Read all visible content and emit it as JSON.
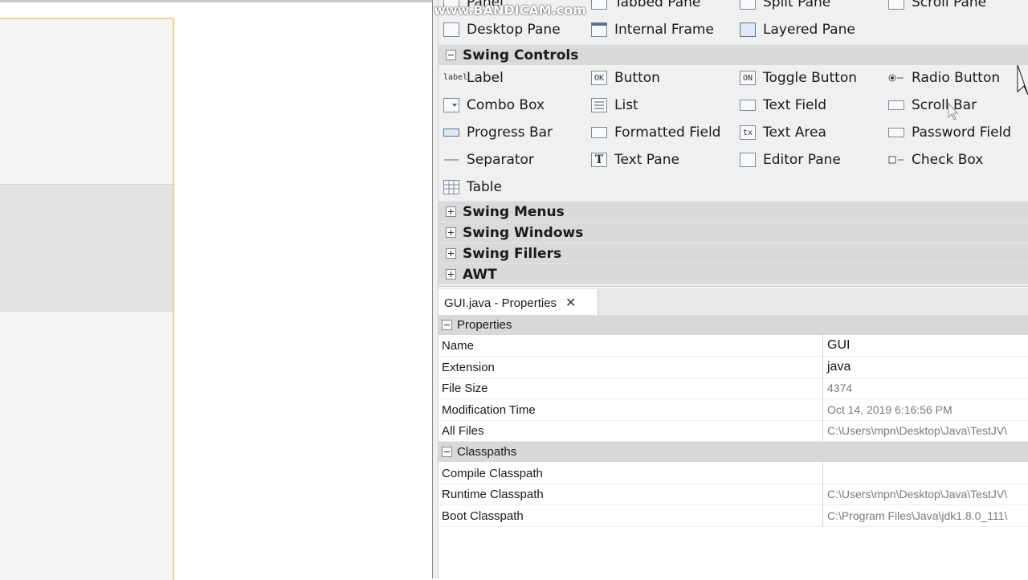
{
  "watermark": "www.BANDICAM.com",
  "palette": {
    "top_partial_row": [
      "Panel",
      "Tabbed Pane",
      "Split Pane",
      "Scroll Pane"
    ],
    "containers_row2": [
      "Desktop Pane",
      "Internal Frame",
      "Layered Pane"
    ],
    "swing_controls": {
      "header": "Swing Controls",
      "rows": [
        [
          "Label",
          "Button",
          "Toggle Button",
          "Radio Button"
        ],
        [
          "Combo Box",
          "List",
          "Text Field",
          "Scroll Bar"
        ],
        [
          "Progress Bar",
          "Formatted Field",
          "Text Area",
          "Password Field"
        ],
        [
          "Separator",
          "Text Pane",
          "Editor Pane",
          "Check Box"
        ],
        [
          "Table"
        ]
      ],
      "icon_labels": {
        "label": "label",
        "button": "OK",
        "toggle": "ON",
        "text_area": "tx"
      }
    },
    "collapsed_categories": [
      "Swing Menus",
      "Swing Windows",
      "Swing Fillers",
      "AWT"
    ]
  },
  "properties_panel": {
    "tab_label": "GUI.java - Properties",
    "close_glyph": "✕",
    "sections": [
      {
        "title": "Properties",
        "rows": [
          {
            "name": "Name",
            "value": "GUI"
          },
          {
            "name": "Extension",
            "value": "java"
          },
          {
            "name": "File Size",
            "value": "4374"
          },
          {
            "name": "Modification Time",
            "value": "Oct 14, 2019 6:16:56 PM"
          },
          {
            "name": "All Files",
            "value": "C:\\Users\\mpn\\Desktop\\Java\\TestJV\\"
          }
        ]
      },
      {
        "title": "Classpaths",
        "rows": [
          {
            "name": "Compile Classpath",
            "value": ""
          },
          {
            "name": "Runtime Classpath",
            "value": "C:\\Users\\mpn\\Desktop\\Java\\TestJV\\"
          },
          {
            "name": "Boot Classpath",
            "value": "C:\\Program Files\\Java\\jdk1.8.0_111\\"
          }
        ]
      }
    ]
  }
}
